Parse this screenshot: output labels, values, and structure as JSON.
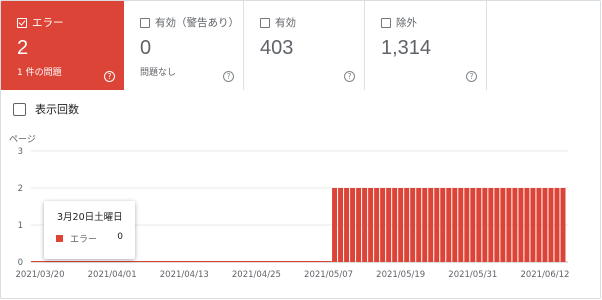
{
  "tiles": [
    {
      "label": "エラー",
      "value": "2",
      "subtitle": "1 件の問題",
      "checked": true,
      "help": "?"
    },
    {
      "label": "有効（警告あり）",
      "value": "0",
      "subtitle": "問題なし",
      "checked": false,
      "help": "?"
    },
    {
      "label": "有効",
      "value": "403",
      "subtitle": "",
      "checked": false,
      "help": "?"
    },
    {
      "label": "除外",
      "value": "1,314",
      "subtitle": "",
      "checked": false,
      "help": "?"
    }
  ],
  "impressions_toggle": {
    "label": "表示回数",
    "checked": false
  },
  "tooltip": {
    "date": "3月20日土曜日",
    "series": "エラー",
    "value": "0"
  },
  "colors": {
    "error": "#db4437",
    "axis_text": "#5f6368",
    "grid": "#e0e0e0"
  },
  "chart_data": {
    "type": "bar",
    "ylabel": "ページ",
    "ylim": [
      0,
      3
    ],
    "yticks": [
      "0",
      "1",
      "2",
      "3"
    ],
    "x_tick_labels": [
      "2021/03/20",
      "2021/04/01",
      "2021/04/13",
      "2021/04/25",
      "2021/05/07",
      "2021/05/19",
      "2021/05/31",
      "2021/06/12"
    ],
    "start_date": "2021-03-20",
    "end_date": "2021-06-16",
    "error_from_date": "2021-05-09",
    "series": [
      {
        "name": "エラー",
        "color": "#db4437",
        "value_before": 0,
        "value_after": 2
      }
    ]
  }
}
